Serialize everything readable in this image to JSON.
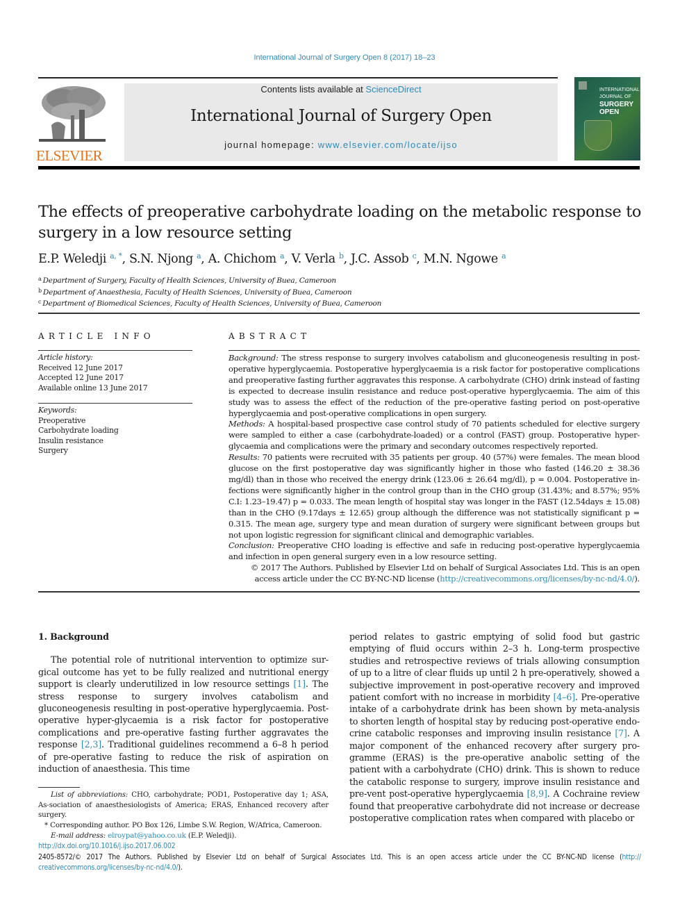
{
  "running_head": "International Journal of Surgery Open 8 (2017) 18–23",
  "masthead": {
    "publisher_wordmark": "ELSEVIER",
    "contents_prefix": "Contents lists available at ",
    "contents_link": "ScienceDirect",
    "journal_name": "International Journal of Surgery Open",
    "homepage_prefix": "journal homepage: ",
    "homepage_link": "www.elsevier.com/locate/ijso",
    "cover": {
      "line1": "INTERNATIONAL",
      "line2": "JOURNAL OF",
      "line3": "SURGERY",
      "line4": "OPEN"
    }
  },
  "article": {
    "title": "The effects of preoperative carbohydrate loading on the metabolic response to surgery in a low resource setting",
    "authors": [
      {
        "name": "E.P. Weledji",
        "sup": "a, *"
      },
      {
        "name": "S.N. Njong",
        "sup": "a"
      },
      {
        "name": "A. Chichom",
        "sup": "a"
      },
      {
        "name": "V. Verla",
        "sup": "b"
      },
      {
        "name": "J.C. Assob",
        "sup": "c"
      },
      {
        "name": "M.N. Ngowe",
        "sup": "a"
      }
    ],
    "affiliations": [
      {
        "mark": "a",
        "text": "Department of Surgery, Faculty of Health Sciences, University of Buea, Cameroon"
      },
      {
        "mark": "b",
        "text": "Department of Anaesthesia, Faculty of Health Sciences, University of Buea, Cameroon"
      },
      {
        "mark": "c",
        "text": "Department of Biomedical Sciences, Faculty of Health Sciences, University of Buea, Cameroon"
      }
    ]
  },
  "article_info": {
    "heading": "ARTICLE INFO",
    "history_label": "Article history:",
    "history": [
      "Received 12 June 2017",
      "Accepted 12 June 2017",
      "Available online 13 June 2017"
    ],
    "keywords_label": "Keywords:",
    "keywords": [
      "Preoperative",
      "Carbohydrate loading",
      "Insulin resistance",
      "Surgery"
    ]
  },
  "abstract": {
    "heading": "ABSTRACT",
    "background_label": "Background:",
    "background": " The stress response to surgery involves catabolism and gluconeogenesis resulting in post-operative hyperglycaemia. Postoperative hyperglycaemia is a risk factor for postoperative complications and preoperative fasting further aggravates this response. A carbohydrate (CHO) drink instead of fasting is expected to decrease insulin resistance and reduce post-operative hyperglycaemia. The aim of this study was to assess the effect of the reduction of the pre-operative fasting period on post-operative hyperglycaemia and post-operative complications in open surgery.",
    "methods_label": "Methods:",
    "methods": " A hospital-based prospective case control study of 70 patients scheduled for elective surgery were sampled to either a case (carbohydrate-loaded) or a control (FAST) group. Postoperative hyper-glycaemia and complications were the primary and secondary outcomes respectively reported.",
    "results_label": "Results:",
    "results": " 70 patients were recruited with 35 patients per group. 40 (57%) were females. The mean blood glucose on the first postoperative day was significantly higher in those who fasted (146.20 ± 38.36 mg/dl) than in those who received the energy drink (123.06 ± 26.64 mg/dl), p = 0.004. Postoperative in-fections were significantly higher in the control group than in the CHO group (31.43%; and 8.57%; 95% C.I: 1.23–19.47) p = 0.033. The mean length of hospital stay was longer in the FAST (12.54days ± 15.08) than in the CHO (9.17days ± 12.65) group although the difference was not statistically significant p = 0.315. The mean age, surgery type and mean duration of surgery were significant between groups but not upon logistic regression for significant clinical and demographic variables.",
    "conclusion_label": "Conclusion:",
    "conclusion": " Preoperative CHO loading is effective and safe in reducing post-operative hyperglycaemia and infection in open general surgery even in a low resource setting.",
    "copyright": "© 2017 The Authors. Published by Elsevier Ltd on behalf of Surgical Associates Ltd. This is an open access article under the CC BY-NC-ND license (",
    "license_link": "http://creativecommons.org/licenses/by-nc-nd/4.0/",
    "copyright_end": ")."
  },
  "body": {
    "section_heading": "1.  Background",
    "left_parts": [
      "The potential role of nutritional intervention to optimize sur-gical outcome has yet to be fully realized and nutritional energy support is clearly underutilized in low resource settings ",
      "[1]",
      ". The stress response to surgery involves catabolism and gluconeogenesis resulting in post-operative hyperglycaemia. Post-operative hyper-glycaemia is a risk factor for postoperative complications and pre-operative fasting further aggravates the response ",
      "[2,3]",
      ". Traditional guidelines recommend a 6–8 h period of pre-operative fasting to reduce the risk of aspiration on induction of anaesthesia. This time"
    ],
    "right_parts": [
      "period relates to gastric emptying of solid food but gastric emptying of fluid occurs within 2–3 h. Long-term prospective studies and retrospective reviews of trials allowing consumption of up to a litre of clear fluids up until 2 h pre-operatively, showed a subjective improvement in post-operative recovery and improved patient comfort with no increase in morbidity ",
      "[4–6]",
      ". Pre-operative intake of a carbohydrate drink has been shown by meta-analysis to shorten length of hospital stay by reducing post-operative endo-crine catabolic responses and improving insulin resistance ",
      "[7]",
      ". A major component of the enhanced recovery after surgery pro-gramme (ERAS) is the pre-operative anabolic setting of the patient with a carbohydrate (CHO) drink. This is shown to reduce the catabolic response to surgery, improve insulin resistance and pre-vent post-operative hyperglycaemia ",
      "[8,9]",
      ". A Cochraine review found that preoperative carbohydrate did not increase or decrease postoperative complication rates when compared with placebo or"
    ]
  },
  "footnotes": {
    "abbrev_label": "List of abbreviations:",
    "abbrev_text": " CHO, carbohydrate; POD1, Postoperative day 1; ASA, As-sociation of anaesthesiologists of America; ERAS, Enhanced recovery after surgery.",
    "corresponding": "* Corresponding author. PO Box 126, Limbe S.W. Region, W/Africa, Cameroon.",
    "email_label": "E-mail address:",
    "email": "elroypat@yahoo.co.uk",
    "email_owner": " (E.P. Weledji)."
  },
  "doi": {
    "link": "http://dx.doi.org/10.1016/j.ijso.2017.06.002",
    "issn_text": "2405-8572/© 2017 The Authors. Published by Elsevier Ltd on behalf of Surgical Associates Ltd. This is an open access article under the CC BY-NC-ND license (",
    "license_link_part1": "http://",
    "license_link_part2": "creativecommons.org/licenses/by-nc-nd/4.0/",
    "end": ")."
  }
}
